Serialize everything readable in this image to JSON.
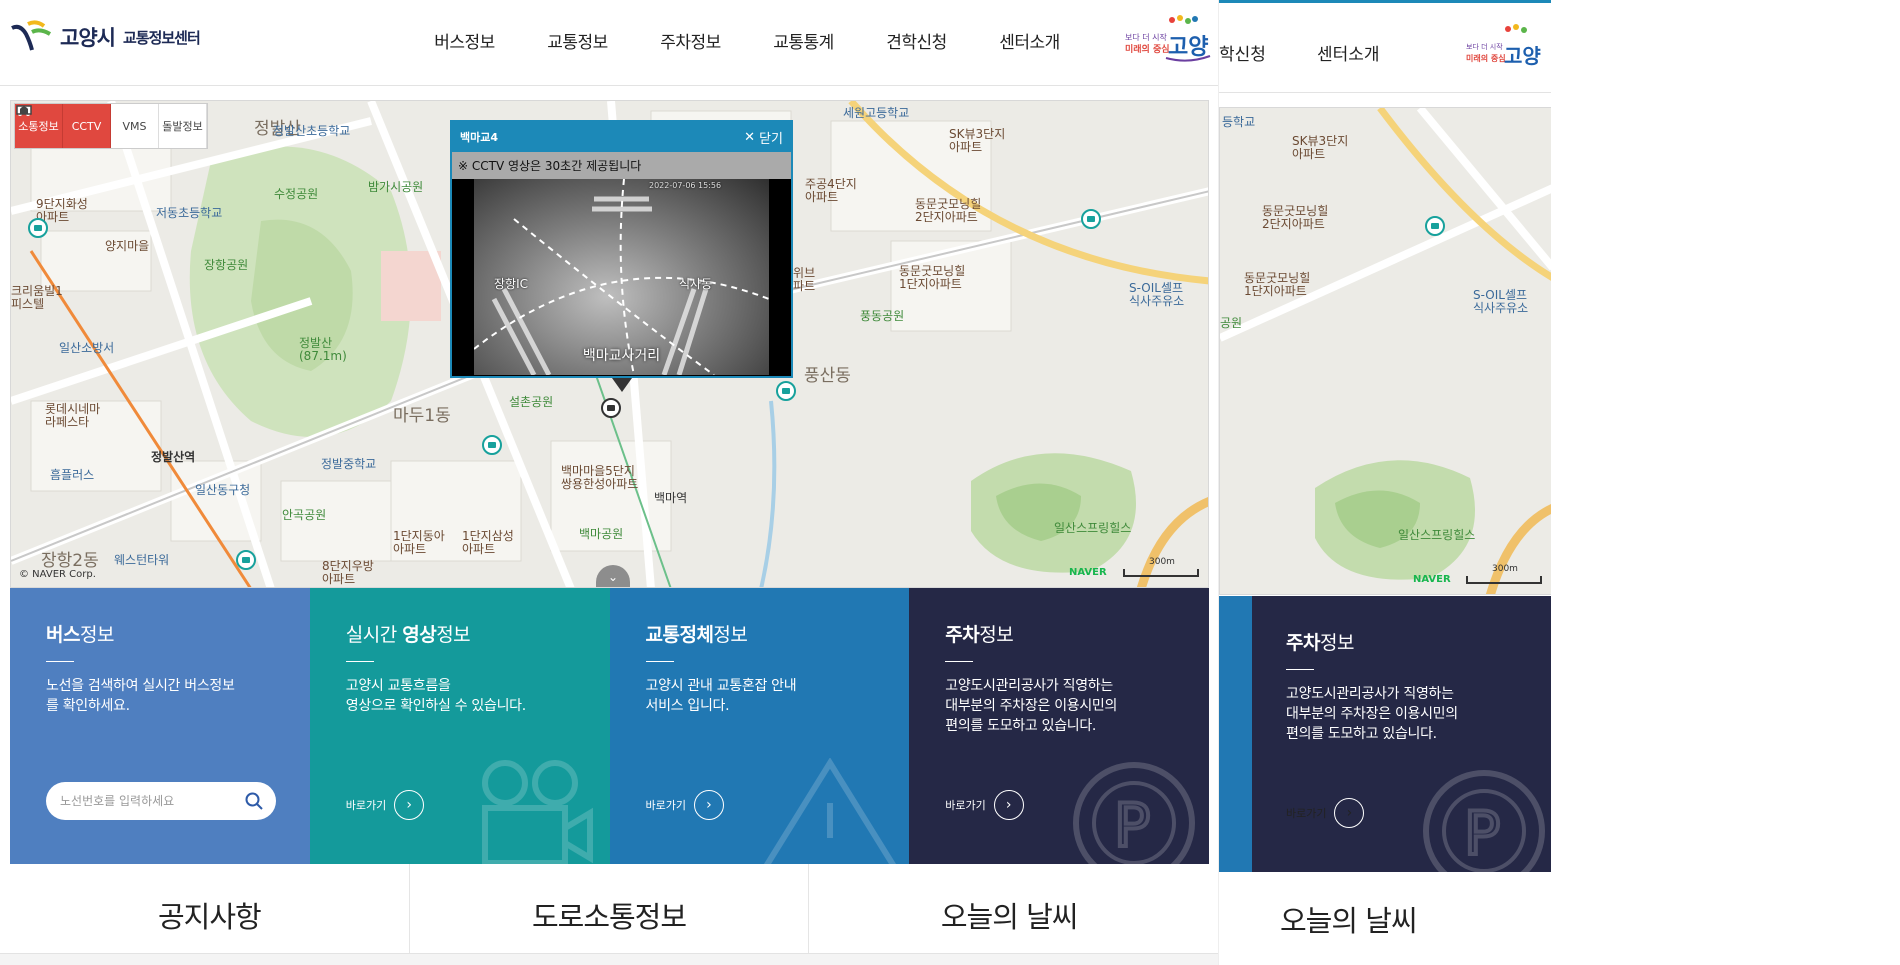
{
  "header": {
    "logo_name": "고양시",
    "logo_sub": "교통정보센터",
    "nav": [
      "버스정보",
      "교통정보",
      "주차정보",
      "교통통계",
      "견학신청",
      "센터소개"
    ],
    "brand_text_small": "보다 더 시작 미래의 중심",
    "brand_text_big": "고양"
  },
  "map": {
    "tabs": [
      {
        "label": "소통정보",
        "icon": "car-icon",
        "active": true
      },
      {
        "label": "CCTV",
        "icon": "cctv-icon",
        "active": true
      },
      {
        "label": "VMS",
        "icon": "vms-icon",
        "active": false
      },
      {
        "label": "돌발정보",
        "icon": "alert-icon",
        "active": false
      }
    ],
    "labels": {
      "jeongbalsan_dong": "정발산",
      "jeongbalsan_elem": "정발산초등학교",
      "jeongbalsan_park_top": "밤가시공원",
      "suseong_park": "수정공원",
      "jeodong_elem": "저동초등학교",
      "yangji": "양지마을",
      "janghang_park": "장항공원",
      "ninth_apt": "9단지화성\n아파트",
      "jeongbalsan": "정발산\n(87.1m)",
      "krrm": "크리움빌1\n피스텔",
      "ilsan_fire": "일산소방서",
      "lotte": "롯데시네마\n라페스타",
      "heumeul": "흠플러스",
      "ilsan_police": "일산동구청",
      "jeongbal_station": "정발산역",
      "jeongbal_middle": "정발중학교",
      "madu1": "마두1동",
      "seolchon": "설촌공원",
      "angok": "안곡공원",
      "janghang2": "장항2동",
      "westentower": "웨스턴타워",
      "8danji": "8단지우방\n아파트",
      "1danji_a": "1단지동아\n아파트",
      "1danji_b": "1단지삼성\n아파트",
      "baekma_park": "백마공원",
      "baekma_station": "백마역",
      "baekma_5": "백마마을5단지\n쌍용한성아파트",
      "sewon": "세원고등학교",
      "sk3": "SK뷰3단지\n아파트",
      "jugong4": "주공4단지\n아파트",
      "dongmun2": "동문굿모닝힐\n2단지아파트",
      "dongmun1": "동문굿모닝힐\n1단지아파트",
      "hanwee": "한위브\n아파트",
      "pungdong_park": "풍동공원",
      "pungsan": "풍산동",
      "soil": "S-OIL셀프\n식사주유소",
      "springhills": "일산스프링힐스",
      "copyright": "© NAVER Corp.",
      "naver": "NAVER",
      "scale": "300m"
    },
    "popup": {
      "title": "백마교4",
      "close": "닫기",
      "notice": "※ CCTV 영상은 30초간 제공됩니다",
      "timestamp": "2022-07-06 15:56",
      "left_label": "장항IC",
      "right_label": "식사동",
      "caption": "백마교사거리"
    }
  },
  "services": [
    {
      "title_strong": "버스",
      "title_rest": "정보",
      "prefix": "",
      "desc": "노선을 검색하여 실시간 버스정보\n를 확인하세요.",
      "search_placeholder": "노선번호를 입력하세요",
      "color": "#4f7fc0"
    },
    {
      "title_strong": "영상",
      "title_rest": "정보",
      "prefix": "실시간 ",
      "desc": "고양시 교통흐름을\n영상으로 확인하실 수 있습니다.",
      "go": "바로가기",
      "color": "#149a9b"
    },
    {
      "title_strong": "교통정체",
      "title_rest": "정보",
      "prefix": "",
      "desc": "고양시 관내 교통혼잡 안내\n서비스 입니다.",
      "go": "바로가기",
      "color": "#2178b3"
    },
    {
      "title_strong": "주차",
      "title_rest": "정보",
      "prefix": "",
      "desc": "고양도시관리공사가 직영하는\n대부분의 주차장은 이용시민의\n편의를 도모하고 있습니다.",
      "go": "바로가기",
      "color": "#252846"
    }
  ],
  "bottom_tabs": [
    "공지사항",
    "도로소통정보",
    "오늘의 날씨"
  ],
  "overlay": {
    "nav": [
      "학신청",
      "센터소개"
    ],
    "brand_text_small": "보다 더 시작 미래의 중심",
    "brand_text_big": "고양",
    "map_labels": {
      "school": "등학교",
      "sk3": "SK뷰3단지\n아파트",
      "dongmun2": "동문굿모닝힐\n2단지아파트",
      "dongmun1": "동문굿모닝힐\n1단지아파트",
      "park": "공원",
      "soil": "S-OIL셀프\n식사주유소",
      "springhills": "일산스프링힐스",
      "naver": "NAVER",
      "scale": "300m"
    },
    "parking": {
      "title_strong": "주차",
      "title_rest": "정보",
      "desc": "고양도시관리공사가 직영하는\n대부분의 주차장은 이용시민의\n편의를 도모하고 있습니다.",
      "go": "바로가기"
    },
    "weather": "오늘의 날씨"
  }
}
